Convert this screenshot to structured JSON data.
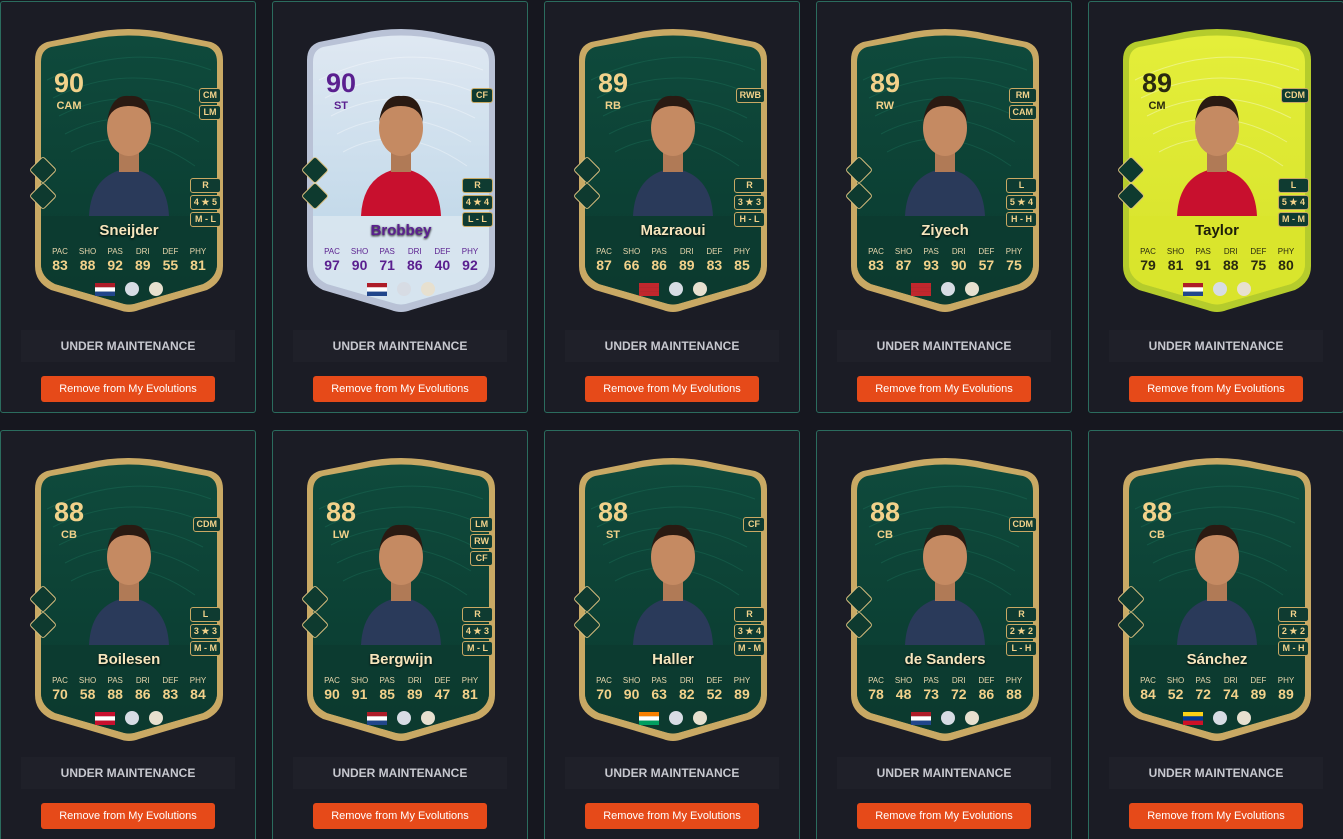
{
  "maintenance_label": "UNDER MAINTENANCE",
  "remove_label": "Remove from My Evolutions",
  "stat_labels": [
    "PAC",
    "SHO",
    "PAS",
    "DRI",
    "DEF",
    "PHY"
  ],
  "colors": {
    "accent_button": "#e64a19",
    "card_green": "#0f4a3c",
    "card_gold": "#c9a964",
    "tile_border": "#2b6c5e",
    "background": "#16171f"
  },
  "cards": [
    {
      "name": "Sneijder",
      "rating": "90",
      "position": "CAM",
      "alt_positions": [
        "CM",
        "LM"
      ],
      "foot": "R",
      "skills": "4 ★ 5",
      "workrate": "M - L",
      "stats": [
        "83",
        "88",
        "92",
        "89",
        "55",
        "81"
      ],
      "theme": "green",
      "flag": "Netherlands"
    },
    {
      "name": "Brobbey",
      "rating": "90",
      "position": "ST",
      "alt_positions": [
        "CF"
      ],
      "foot": "R",
      "skills": "4 ★ 4",
      "workrate": "L - L",
      "stats": [
        "97",
        "90",
        "71",
        "86",
        "40",
        "92"
      ],
      "theme": "white",
      "flag": "Netherlands"
    },
    {
      "name": "Mazraoui",
      "rating": "89",
      "position": "RB",
      "alt_positions": [
        "RWB"
      ],
      "foot": "R",
      "skills": "3 ★ 3",
      "workrate": "H - L",
      "stats": [
        "87",
        "66",
        "86",
        "89",
        "83",
        "85"
      ],
      "theme": "green",
      "flag": "Morocco"
    },
    {
      "name": "Ziyech",
      "rating": "89",
      "position": "RW",
      "alt_positions": [
        "RM",
        "CAM"
      ],
      "foot": "L",
      "skills": "5 ★ 4",
      "workrate": "H - H",
      "stats": [
        "83",
        "87",
        "93",
        "90",
        "57",
        "75"
      ],
      "theme": "green",
      "flag": "Morocco"
    },
    {
      "name": "Taylor",
      "rating": "89",
      "position": "CM",
      "alt_positions": [
        "CDM"
      ],
      "foot": "L",
      "skills": "5 ★ 4",
      "workrate": "M - M",
      "stats": [
        "79",
        "81",
        "91",
        "88",
        "75",
        "80"
      ],
      "theme": "yellow",
      "flag": "Netherlands"
    },
    {
      "name": "Boilesen",
      "rating": "88",
      "position": "CB",
      "alt_positions": [
        "CDM"
      ],
      "foot": "L",
      "skills": "3 ★ 3",
      "workrate": "M - M",
      "stats": [
        "70",
        "58",
        "88",
        "86",
        "83",
        "84"
      ],
      "theme": "green",
      "flag": "Denmark"
    },
    {
      "name": "Bergwijn",
      "rating": "88",
      "position": "LW",
      "alt_positions": [
        "LM",
        "RW",
        "CF"
      ],
      "foot": "R",
      "skills": "4 ★ 3",
      "workrate": "M - L",
      "stats": [
        "90",
        "91",
        "85",
        "89",
        "47",
        "81"
      ],
      "theme": "green",
      "flag": "Netherlands"
    },
    {
      "name": "Haller",
      "rating": "88",
      "position": "ST",
      "alt_positions": [
        "CF"
      ],
      "foot": "R",
      "skills": "3 ★ 4",
      "workrate": "M - M",
      "stats": [
        "70",
        "90",
        "63",
        "82",
        "52",
        "89"
      ],
      "theme": "green",
      "flag": "Ivory Coast"
    },
    {
      "name": "de Sanders",
      "rating": "88",
      "position": "CB",
      "alt_positions": [
        "CDM"
      ],
      "foot": "R",
      "skills": "2 ★ 2",
      "workrate": "L - H",
      "stats": [
        "78",
        "48",
        "73",
        "72",
        "86",
        "88"
      ],
      "theme": "green",
      "flag": "Netherlands"
    },
    {
      "name": "Sánchez",
      "rating": "88",
      "position": "CB",
      "alt_positions": [],
      "foot": "R",
      "skills": "2 ★ 2",
      "workrate": "M - H",
      "stats": [
        "84",
        "52",
        "72",
        "74",
        "89",
        "89"
      ],
      "theme": "green",
      "flag": "Colombia"
    }
  ]
}
